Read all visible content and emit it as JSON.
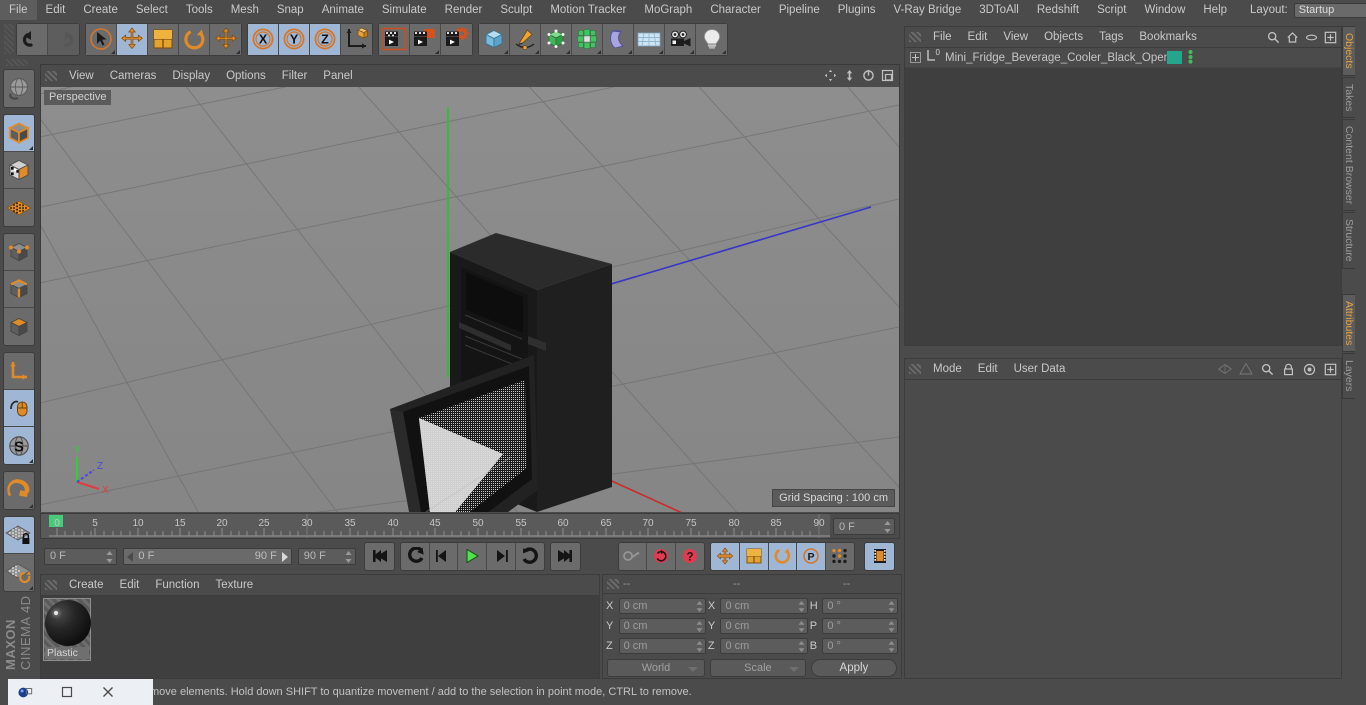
{
  "app": {
    "title": "Cinema 4D",
    "brand_line1": "MAXON",
    "brand_line2": "CINEMA 4D"
  },
  "menubar": {
    "items": [
      {
        "label": "File"
      },
      {
        "label": "Edit"
      },
      {
        "label": "Create"
      },
      {
        "label": "Select"
      },
      {
        "label": "Tools"
      },
      {
        "label": "Mesh"
      },
      {
        "label": "Snap"
      },
      {
        "label": "Animate"
      },
      {
        "label": "Simulate"
      },
      {
        "label": "Render"
      },
      {
        "label": "Sculpt"
      },
      {
        "label": "Motion Tracker"
      },
      {
        "label": "MoGraph"
      },
      {
        "label": "Character"
      },
      {
        "label": "Pipeline"
      },
      {
        "label": "Plugins"
      },
      {
        "label": "V-Ray Bridge"
      },
      {
        "label": "3DToAll"
      },
      {
        "label": "Redshift"
      },
      {
        "label": "Script"
      },
      {
        "label": "Window"
      },
      {
        "label": "Help"
      }
    ],
    "layout_label": "Layout:",
    "layout_value": "Startup"
  },
  "toolbar": {
    "groups": [
      {
        "name": "history",
        "buttons": [
          {
            "name": "undo-button",
            "icon": "undo",
            "state": "normal"
          },
          {
            "name": "redo-button",
            "icon": "redo",
            "state": "disabled"
          }
        ]
      },
      {
        "name": "transform",
        "buttons": [
          {
            "name": "live-selection-tool",
            "icon": "cursor-circle",
            "state": "normal",
            "corner": true
          },
          {
            "name": "move-tool",
            "icon": "move-arrows",
            "state": "selected"
          },
          {
            "name": "scale-tool",
            "icon": "scale-box",
            "state": "normal"
          },
          {
            "name": "rotate-tool",
            "icon": "rotate-arc",
            "state": "normal"
          },
          {
            "name": "dynamic-place-tool",
            "icon": "move-arrows",
            "state": "normal",
            "corner": true
          }
        ]
      },
      {
        "name": "axis-locks",
        "buttons": [
          {
            "name": "lock-x-axis",
            "icon": "axis-x",
            "state": "selected"
          },
          {
            "name": "lock-y-axis",
            "icon": "axis-y",
            "state": "selected"
          },
          {
            "name": "lock-z-axis",
            "icon": "axis-z",
            "state": "selected"
          },
          {
            "name": "world-object-axis",
            "icon": "world-axis",
            "state": "normal"
          }
        ]
      },
      {
        "name": "render",
        "buttons": [
          {
            "name": "render-view-button",
            "icon": "clapper-frame",
            "state": "normal"
          },
          {
            "name": "render-to-picture-viewer-button",
            "icon": "clapper-square",
            "state": "normal",
            "corner": true
          },
          {
            "name": "edit-render-settings-button",
            "icon": "clapper-gear",
            "state": "normal"
          }
        ]
      },
      {
        "name": "objects",
        "buttons": [
          {
            "name": "add-cube-button",
            "icon": "cube-blue",
            "state": "normal",
            "corner": true
          },
          {
            "name": "add-spline-button",
            "icon": "pen-spline",
            "state": "normal",
            "corner": true
          },
          {
            "name": "add-generator-button",
            "icon": "cube-green-cage",
            "state": "normal",
            "corner": true
          },
          {
            "name": "add-mograph-button",
            "icon": "cloner-green",
            "state": "normal",
            "corner": true
          },
          {
            "name": "add-deformer-button",
            "icon": "bend-purple",
            "state": "normal",
            "corner": true
          },
          {
            "name": "add-environment-button",
            "icon": "floor-grid",
            "state": "normal",
            "corner": true
          },
          {
            "name": "add-camera-button",
            "icon": "camera",
            "state": "normal",
            "corner": true
          },
          {
            "name": "add-light-button",
            "icon": "light-bulb",
            "state": "normal",
            "corner": true
          }
        ]
      }
    ]
  },
  "left_palette": {
    "groups": [
      {
        "buttons": [
          {
            "name": "undo-view-button",
            "icon": "globe-undo",
            "state": "normal"
          }
        ]
      },
      {
        "buttons": [
          {
            "name": "model-mode-button",
            "icon": "cube-orange-outline",
            "state": "selected",
            "corner": true
          },
          {
            "name": "texture-mode-button",
            "icon": "cube-checker",
            "state": "normal"
          },
          {
            "name": "workplane-mode-button",
            "icon": "plane-grid-orange",
            "state": "normal"
          }
        ]
      },
      {
        "buttons": [
          {
            "name": "points-mode-button",
            "icon": "cube-points",
            "state": "normal"
          },
          {
            "name": "edges-mode-button",
            "icon": "cube-edges",
            "state": "normal"
          },
          {
            "name": "polygons-mode-button",
            "icon": "cube-polys",
            "state": "normal"
          }
        ]
      },
      {
        "buttons": [
          {
            "name": "object-axis-mode-button",
            "icon": "axis-l",
            "state": "normal"
          },
          {
            "name": "enable-axis-modification-button",
            "icon": "mouse-axis",
            "state": "selected"
          },
          {
            "name": "world-coordinates-button",
            "icon": "s-globe",
            "state": "selected",
            "corner": true
          }
        ]
      },
      {
        "buttons": [
          {
            "name": "enable-snapping-button",
            "icon": "magnet",
            "state": "normal",
            "corner": true
          }
        ]
      },
      {
        "buttons": [
          {
            "name": "lock-workplane-button",
            "icon": "plane-lock",
            "state": "selected"
          },
          {
            "name": "planar-workplane-button",
            "icon": "plane-rotate",
            "state": "normal",
            "corner": true
          }
        ]
      }
    ]
  },
  "viewport": {
    "menu": [
      {
        "label": "View"
      },
      {
        "label": "Cameras"
      },
      {
        "label": "Display"
      },
      {
        "label": "Options"
      },
      {
        "label": "Filter"
      },
      {
        "label": "Panel"
      }
    ],
    "view_label": "Perspective",
    "grid_spacing": "Grid Spacing : 100 cm",
    "axis_labels": {
      "x": "X",
      "y": "Y",
      "z": "Z"
    },
    "header_icons": [
      "pan-view-icon",
      "zoom-view-icon",
      "rotate-view-icon",
      "maximize-view-icon"
    ],
    "scene_description": "Black mini fridge beverage cooler with open glass door"
  },
  "timeline": {
    "ticks": [
      "0",
      "5",
      "10",
      "15",
      "20",
      "25",
      "30",
      "35",
      "40",
      "45",
      "50",
      "55",
      "60",
      "65",
      "70",
      "75",
      "80",
      "85",
      "90"
    ],
    "current_frame_field": "0 F",
    "range_start": "0 F",
    "range_end": "90 F",
    "end_frame_field": "90 F",
    "preview_frame_field": "0 F",
    "playback_buttons": [
      {
        "name": "go-to-start-button",
        "icon": "skip-start"
      },
      {
        "name": "go-to-previous-key-button",
        "icon": "prev-key"
      },
      {
        "name": "step-back-button",
        "icon": "step-back"
      },
      {
        "name": "play-button",
        "icon": "play"
      },
      {
        "name": "step-forward-button",
        "icon": "step-forward"
      },
      {
        "name": "go-to-next-key-button",
        "icon": "next-key"
      },
      {
        "name": "go-to-end-button",
        "icon": "skip-end"
      }
    ],
    "key_buttons": [
      {
        "name": "record-active-objects-button",
        "icon": "key-gray",
        "state": "disabled"
      },
      {
        "name": "autokeying-button",
        "icon": "circle-red-arrows",
        "state": "normal"
      },
      {
        "name": "keyframe-selection-button",
        "icon": "circle-red-question",
        "state": "normal"
      }
    ],
    "key_toggles": [
      {
        "name": "key-position-button",
        "icon": "move-arrows",
        "state": "selected"
      },
      {
        "name": "key-scale-button",
        "icon": "scale-box",
        "state": "selected"
      },
      {
        "name": "key-rotation-button",
        "icon": "rotate-arc",
        "state": "selected"
      },
      {
        "name": "key-parameter-button",
        "icon": "letter-p",
        "state": "selected"
      },
      {
        "name": "key-pla-button",
        "icon": "dot-grid",
        "state": "normal"
      }
    ],
    "extra_buttons": [
      {
        "name": "animation-layers-button",
        "icon": "film-strip",
        "state": "selected"
      }
    ]
  },
  "material_manager": {
    "menu": [
      {
        "label": "Create"
      },
      {
        "label": "Edit"
      },
      {
        "label": "Function"
      },
      {
        "label": "Texture"
      }
    ],
    "materials": [
      {
        "name": "Plastic",
        "selected": true
      }
    ]
  },
  "coordinates": {
    "headers": [
      "--",
      "--",
      "--"
    ],
    "rows": [
      {
        "label1": "X",
        "value1": "0 cm",
        "label2": "X",
        "value2": "0 cm",
        "label3": "H",
        "value3": "0 °"
      },
      {
        "label1": "Y",
        "value1": "0 cm",
        "label2": "Y",
        "value2": "0 cm",
        "label3": "P",
        "value3": "0 °"
      },
      {
        "label1": "Z",
        "value1": "0 cm",
        "label2": "Z",
        "value2": "0 cm",
        "label3": "B",
        "value3": "0 °"
      }
    ],
    "system_select": "World",
    "size_select": "Scale",
    "apply_label": "Apply"
  },
  "object_manager": {
    "menu": [
      {
        "label": "File"
      },
      {
        "label": "Edit"
      },
      {
        "label": "View"
      },
      {
        "label": "Objects"
      },
      {
        "label": "Tags"
      },
      {
        "label": "Bookmarks"
      }
    ],
    "header_icons": [
      "search-icon",
      "home-icon",
      "eye-icon",
      "plus-box-icon"
    ],
    "objects": [
      {
        "name": "Mini_Fridge_Beverage_Cooler_Black_Open",
        "type": "null",
        "level": 0,
        "tag_color": "#26a58e",
        "visibility_dots": "#3fbf5a"
      }
    ]
  },
  "attribute_manager": {
    "menu": [
      {
        "label": "Mode"
      },
      {
        "label": "Edit"
      },
      {
        "label": "User Data"
      }
    ],
    "header_icons": [
      "pin-left-icon",
      "pin-right-icon",
      "search-icon",
      "lock-icon",
      "target-icon",
      "plus-box-icon"
    ]
  },
  "vertical_tabs_top": [
    {
      "label": "Objects",
      "active": true
    },
    {
      "label": "Takes",
      "active": false
    },
    {
      "label": "Content Browser",
      "active": false
    },
    {
      "label": "Structure",
      "active": false
    }
  ],
  "vertical_tabs_bottom": [
    {
      "label": "Attributes",
      "active": true
    },
    {
      "label": "Layers",
      "active": false
    }
  ],
  "statusbar": {
    "text": "move elements. Hold down SHIFT to quantize movement / add to the selection in point mode, CTRL to remove."
  },
  "taskbar": {
    "items": [
      {
        "name": "c4d-app-icon",
        "icon": "c4d-logo"
      },
      {
        "name": "restore-window-button",
        "icon": "square"
      },
      {
        "name": "close-window-button",
        "icon": "x"
      }
    ]
  },
  "colors": {
    "panel_bg": "#4b4b4b",
    "field_bg": "#5c5c5c",
    "selected_blue": "#9fb6d4",
    "accent_orange": "#e8a33d",
    "viewport_bg": "#8a8a8a",
    "axis_x": "#cc3333",
    "axis_y": "#33cc33",
    "axis_z": "#3333cc"
  }
}
